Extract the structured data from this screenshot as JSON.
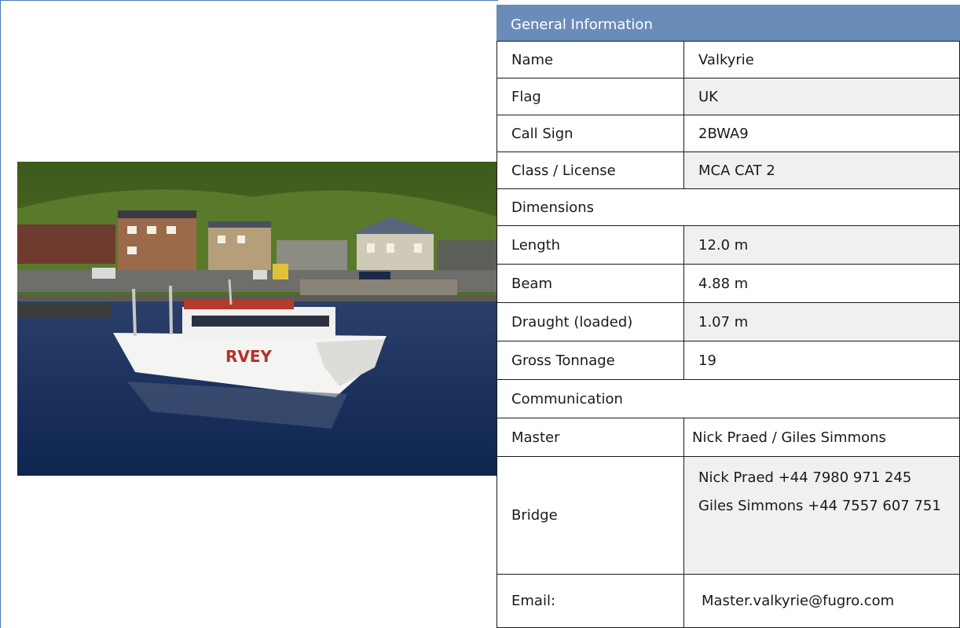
{
  "photo": {
    "hull_lettering": "RVEY"
  },
  "general": {
    "title": "General Information",
    "rows": [
      {
        "label": "Name",
        "value": "Valkyrie"
      },
      {
        "label": "Flag",
        "value": "UK"
      },
      {
        "label": "Call Sign",
        "value": "2BWA9"
      },
      {
        "label": "Class / License",
        "value": "MCA CAT 2"
      }
    ]
  },
  "dimensions": {
    "title": "Dimensions",
    "rows": [
      {
        "label": "Length",
        "value": "12.0 m"
      },
      {
        "label": "Beam",
        "value": "4.88 m"
      },
      {
        "label": "Draught (loaded)",
        "value": "1.07 m"
      },
      {
        "label": "Gross Tonnage",
        "value": "19"
      }
    ]
  },
  "communication": {
    "title": "Communication",
    "master": {
      "label": "Master",
      "value": "Nick Praed / Giles Simmons"
    },
    "bridge": {
      "label": "Bridge",
      "line1": "Nick Praed +44 7980 971 245",
      "line2": "Giles Simmons +44 7557 607 751"
    },
    "email": {
      "label": "Email:",
      "value": "Master.valkyrie@fugro.com"
    }
  }
}
